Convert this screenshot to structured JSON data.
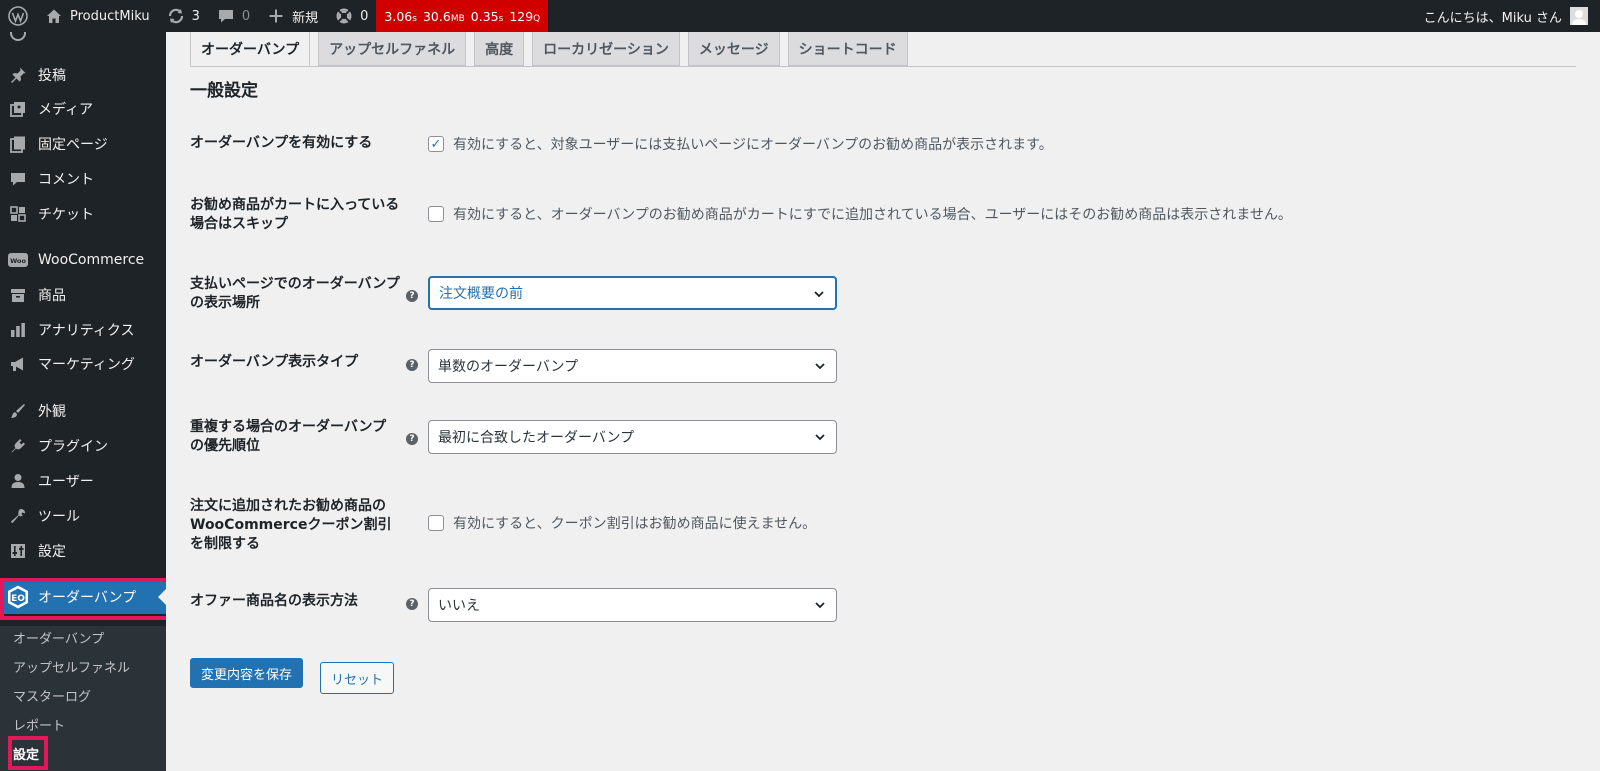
{
  "admin_bar": {
    "site_name": "ProductMiku",
    "updates_count": "3",
    "comments_count": "0",
    "new_label": "新規",
    "plugin_count": "0",
    "perf": {
      "time": "3.06",
      "time_unit": "s",
      "memory": "30.6",
      "memory_unit": "MB",
      "query_time": "0.35",
      "query_time_unit": "s",
      "queries": "129",
      "queries_unit": "Q"
    },
    "greeting": "こんにちは、Miku さん"
  },
  "sidebar": {
    "items": [
      {
        "label": "投稿",
        "icon": "pin-icon"
      },
      {
        "label": "メディア",
        "icon": "media-icon"
      },
      {
        "label": "固定ページ",
        "icon": "page-icon"
      },
      {
        "label": "コメント",
        "icon": "comment-icon"
      },
      {
        "label": "チケット",
        "icon": "ticket-icon"
      },
      {
        "label": "WooCommerce",
        "icon": "woo-icon"
      },
      {
        "label": "商品",
        "icon": "archive-icon"
      },
      {
        "label": "アナリティクス",
        "icon": "chart-icon"
      },
      {
        "label": "マーケティング",
        "icon": "megaphone-icon"
      },
      {
        "label": "外観",
        "icon": "brush-icon"
      },
      {
        "label": "プラグイン",
        "icon": "plugin-icon"
      },
      {
        "label": "ユーザー",
        "icon": "user-icon"
      },
      {
        "label": "ツール",
        "icon": "wrench-icon"
      },
      {
        "label": "設定",
        "icon": "settings-icon"
      }
    ],
    "active_item": {
      "label": "オーダーバンプ",
      "icon": "orderbump-icon"
    },
    "submenu": [
      {
        "label": "オーダーバンプ"
      },
      {
        "label": "アップセルファネル"
      },
      {
        "label": "マスターログ"
      },
      {
        "label": "レポート"
      },
      {
        "label": "設定"
      }
    ]
  },
  "tabs": [
    {
      "label": "オーダーバンプ",
      "active": true
    },
    {
      "label": "アップセルファネル"
    },
    {
      "label": "高度"
    },
    {
      "label": "ローカリゼーション"
    },
    {
      "label": "メッセージ"
    },
    {
      "label": "ショートコード"
    }
  ],
  "settings": {
    "section_title": "一般設定",
    "enable": {
      "label": "オーダーバンプを有効にする",
      "checked": true,
      "description": "有効にすると、対象ユーザーには支払いページにオーダーバンプのお勧め商品が表示されます。"
    },
    "skip_in_cart": {
      "label": "お勧め商品がカートに入っている場合はスキップ",
      "checked": false,
      "description": "有効にすると、オーダーバンプのお勧め商品がカートにすでに追加されている場合、ユーザーにはそのお勧め商品は表示されません。"
    },
    "display_position": {
      "label": "支払いページでのオーダーバンプの表示場所",
      "value": "注文概要の前"
    },
    "display_type": {
      "label": "オーダーバンプ表示タイプ",
      "value": "単数のオーダーバンプ"
    },
    "priority": {
      "label": "重複する場合のオーダーバンプの優先順位",
      "value": "最初に合致したオーダーバンプ"
    },
    "restrict_coupon": {
      "label": "注文に追加されたお勧め商品のWooCommerceクーポン割引を制限する",
      "checked": false,
      "description": "有効にすると、クーポン割引はお勧め商品に使えません。"
    },
    "offer_name_display": {
      "label": "オファー商品名の表示方法",
      "value": "いいえ"
    },
    "help_glyph": "?",
    "save_label": "変更内容を保存",
    "reset_label": "リセット"
  },
  "colors": {
    "accent": "#2271b1",
    "adminbar": "#1d2327",
    "highlight": "#e0195b",
    "perf": "#d10000"
  }
}
